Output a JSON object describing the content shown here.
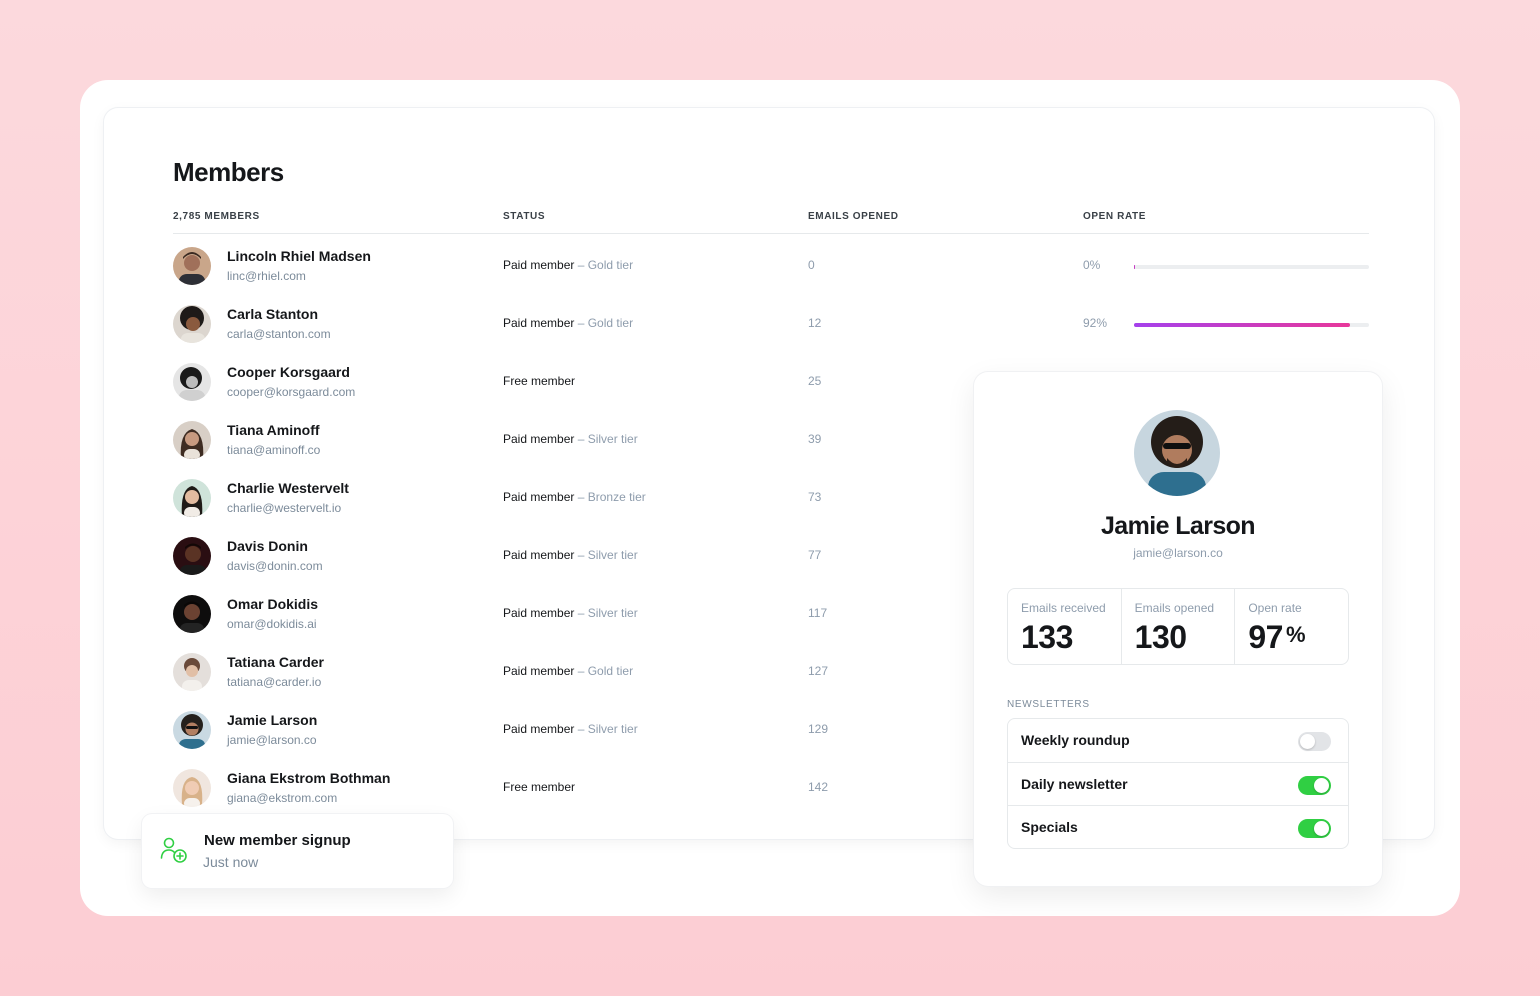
{
  "members_title": "Members",
  "columns": {
    "members": "2,785 MEMBERS",
    "status": "STATUS",
    "emails_opened": "EMAILS OPENED",
    "open_rate": "OPEN RATE"
  },
  "members": [
    {
      "name": "Lincoln Rhiel Madsen",
      "email": "linc@rhiel.com",
      "status": "Paid member",
      "tier": " – Gold tier",
      "opened": "0",
      "rate": "0%",
      "rate_value": 0.005
    },
    {
      "name": "Carla Stanton",
      "email": "carla@stanton.com",
      "status": "Paid member",
      "tier": " – Gold tier",
      "opened": "12",
      "rate": "92%",
      "rate_value": 0.92
    },
    {
      "name": "Cooper Korsgaard",
      "email": "cooper@korsgaard.com",
      "status": "Free member",
      "tier": "",
      "opened": "25"
    },
    {
      "name": "Tiana Aminoff",
      "email": "tiana@aminoff.co",
      "status": "Paid member",
      "tier": " – Silver tier",
      "opened": "39"
    },
    {
      "name": "Charlie Westervelt",
      "email": "charlie@westervelt.io",
      "status": "Paid member",
      "tier": " – Bronze tier",
      "opened": "73"
    },
    {
      "name": "Davis Donin",
      "email": "davis@donin.com",
      "status": "Paid member",
      "tier": " – Silver tier",
      "opened": "77"
    },
    {
      "name": "Omar Dokidis",
      "email": "omar@dokidis.ai",
      "status": "Paid member",
      "tier": " – Silver tier",
      "opened": "117"
    },
    {
      "name": "Tatiana Carder",
      "email": "tatiana@carder.io",
      "status": "Paid member",
      "tier": " – Gold tier",
      "opened": "127"
    },
    {
      "name": "Jamie Larson",
      "email": "jamie@larson.co",
      "status": "Paid member",
      "tier": " – Silver tier",
      "opened": "129"
    },
    {
      "name": "Giana Ekstrom Bothman",
      "email": "giana@ekstrom.com",
      "status": "Free member",
      "tier": "",
      "opened": "142"
    }
  ],
  "notification": {
    "icon": "user-add-icon",
    "title": "New member signup",
    "subtitle": "Just now"
  },
  "profile": {
    "name": "Jamie Larson",
    "email": "jamie@larson.co",
    "stats": [
      {
        "label": "Emails received",
        "value": "133",
        "unit": ""
      },
      {
        "label": "Emails opened",
        "value": "130",
        "unit": ""
      },
      {
        "label": "Open rate",
        "value": "97",
        "unit": "%"
      }
    ],
    "newsletters_label": "NEWSLETTERS",
    "newsletters": [
      {
        "label": "Weekly roundup",
        "enabled": false
      },
      {
        "label": "Daily newsletter",
        "enabled": true
      },
      {
        "label": "Specials",
        "enabled": true
      }
    ]
  },
  "colors": {
    "toggle_on": "#30cf43",
    "toggle_off": "#e2e4e7",
    "bar_gradient_start": "#a540ec",
    "bar_gradient_end": "#e8379a",
    "notification_icon": "#30cf43"
  }
}
